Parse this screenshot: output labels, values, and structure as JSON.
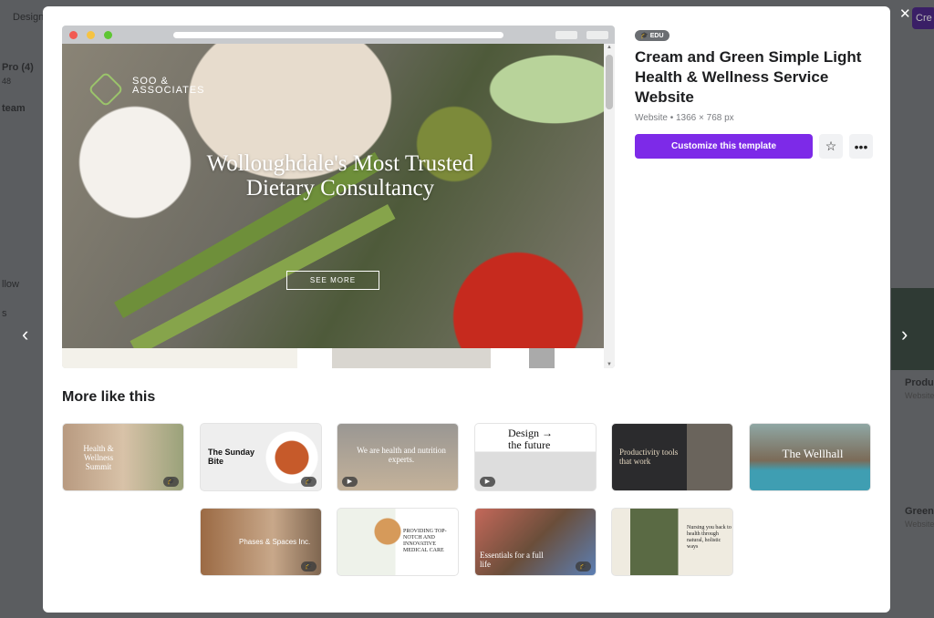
{
  "background": {
    "left": [
      "Design",
      "Pro (4)",
      "48",
      "team",
      "llow",
      "s"
    ],
    "right": [
      "Cre",
      "Produc",
      "Website",
      "Green",
      "Website"
    ]
  },
  "preview": {
    "brand_line1": "SOO &",
    "brand_line2": "ASSOCIATES",
    "headline": "Wolloughdale's Most Trusted Dietary Consultancy",
    "button": "SEE MORE"
  },
  "details": {
    "badge": "EDU",
    "title": "Cream and Green Simple Light Health & Wellness Service Website",
    "meta": "Website • 1366 × 768 px",
    "customize": "Customize this template",
    "star_icon": "star-icon",
    "more_icon": "more-icon"
  },
  "section_title": "More like this",
  "thumbnails": [
    {
      "text": "Health & Wellness Summit",
      "badge": "edu"
    },
    {
      "text": "The Sunday Bite",
      "badge": "edu"
    },
    {
      "text": "We are health and nutrition experts.",
      "badge": "video"
    },
    {
      "text": "Design → the future",
      "badge": "video"
    },
    {
      "text": "Productivity tools that work",
      "badge": "none"
    },
    {
      "text": "The Wellhall",
      "badge": "none"
    },
    {
      "text": "Phases & Spaces Inc.",
      "badge": "edu"
    },
    {
      "text": "PROVIDING TOP-NOTCH AND INNOVATIVE MEDICAL CARE",
      "badge": "none"
    },
    {
      "text": "Essentials for a full life",
      "badge": "edu"
    },
    {
      "text": "Nursing you back to health through natural, holistic ways",
      "badge": "none"
    }
  ],
  "colors": {
    "accent": "#7d2ae8",
    "overlay": "#5b5d60"
  }
}
